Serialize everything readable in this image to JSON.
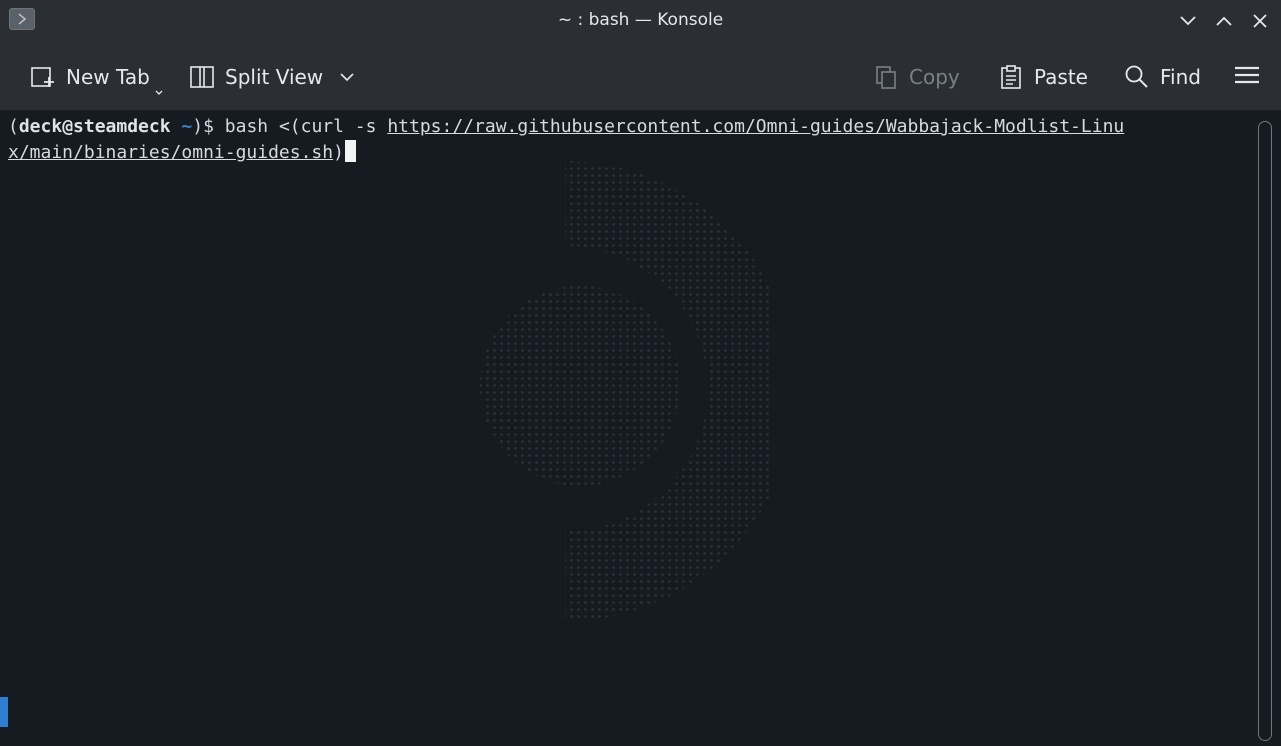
{
  "window": {
    "title": "~ : bash — Konsole"
  },
  "toolbar": {
    "new_tab": "New Tab",
    "split_view": "Split View",
    "copy": "Copy",
    "paste": "Paste",
    "find": "Find"
  },
  "terminal": {
    "prompt_open": "(",
    "prompt_user": "deck@steamdeck",
    "prompt_space": " ",
    "prompt_dir": "~",
    "prompt_close": ")$ ",
    "command": "bash <(curl -s ",
    "url_line1": "https://raw.githubusercontent.com/Omni-guides/Wabbajack-Modlist-Linu",
    "url_line2": "x/main/binaries/omni-guides.sh",
    "command_end": ")"
  },
  "colors": {
    "background": "#161b21",
    "accent": "#3b7fc4"
  },
  "icons": {
    "app": "terminal-app-icon",
    "minimize": "chevron-down-icon",
    "maximize": "chevron-up-icon",
    "close": "close-icon",
    "new_tab": "new-tab-icon",
    "split_view": "split-view-icon",
    "copy": "copy-icon",
    "paste": "paste-icon",
    "find": "search-icon",
    "menu": "hamburger-menu-icon"
  }
}
